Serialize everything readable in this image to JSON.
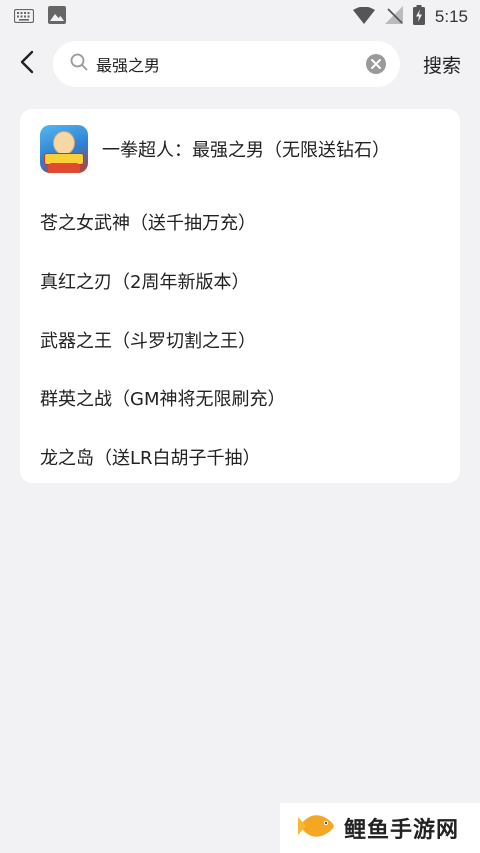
{
  "status_bar": {
    "time": "5:15",
    "left_icons": [
      "keyboard-icon",
      "image-icon"
    ],
    "right_icons": [
      "wifi-icon",
      "no-signal-icon",
      "battery-charging-icon"
    ]
  },
  "search": {
    "query": "最强之男",
    "submit_label": "搜索"
  },
  "results": {
    "top_result": {
      "label": "一拳超人：最强之男（无限送钻石）",
      "icon": "one-punch-man-game-icon"
    },
    "items": [
      {
        "label": "苍之女武神（送千抽万充）"
      },
      {
        "label": "真红之刃（2周年新版本）"
      },
      {
        "label": "武器之王（斗罗切割之王）"
      },
      {
        "label": "群英之战（GM神将无限刷充）"
      },
      {
        "label": "龙之岛（送LR白胡子千抽）"
      }
    ]
  },
  "watermark": {
    "text": "鲤鱼手游网",
    "logo": "fish-logo-icon",
    "accent_color": "#f5a623"
  }
}
